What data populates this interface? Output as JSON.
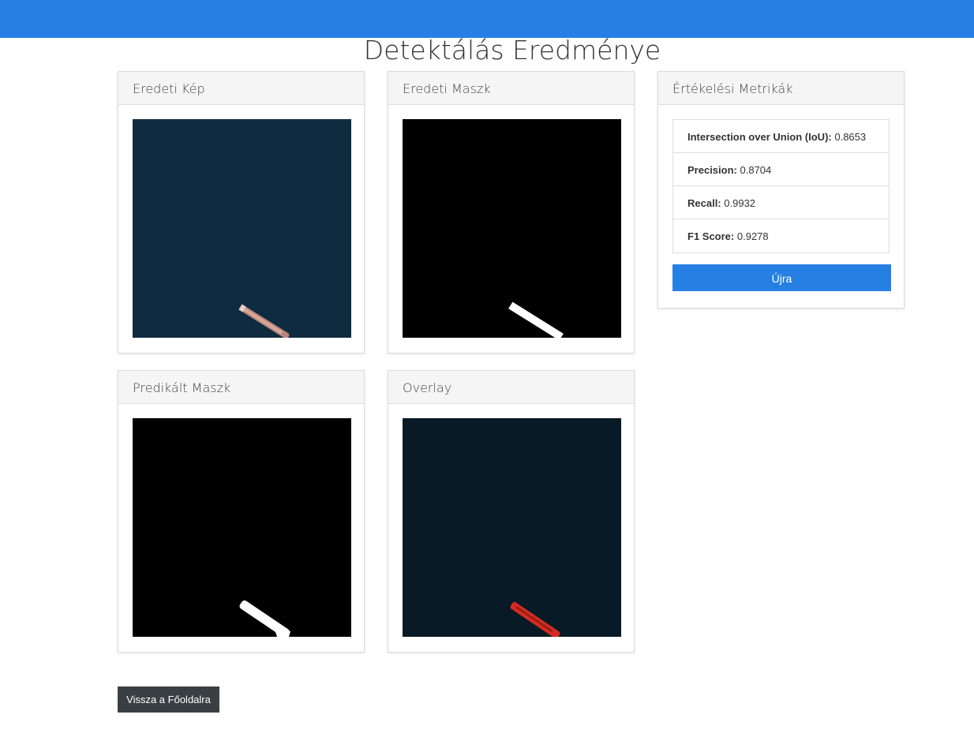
{
  "page": {
    "title": "Detektálás Eredménye"
  },
  "panels": {
    "original_image": {
      "title": "Eredeti Kép"
    },
    "original_mask": {
      "title": "Eredeti Maszk"
    },
    "predicted_mask": {
      "title": "Predikált Maszk"
    },
    "overlay": {
      "title": "Overlay"
    }
  },
  "metrics": {
    "title": "Értékelési Metrikák",
    "items": [
      {
        "label": "Intersection over Union (IoU):",
        "value": "0.8653"
      },
      {
        "label": "Precision:",
        "value": "0.8704"
      },
      {
        "label": "Recall:",
        "value": "0.9932"
      },
      {
        "label": "F1 Score:",
        "value": "0.9278"
      }
    ],
    "retry_label": "Újra"
  },
  "footer": {
    "back_label": "Vissza a Főoldalra"
  },
  "colors": {
    "brand": "#2680e3",
    "sea": "#0f2b3f",
    "overlay_sea": "#071a26",
    "ship_pred": "#d42c22",
    "back_button": "#3a3f44"
  }
}
